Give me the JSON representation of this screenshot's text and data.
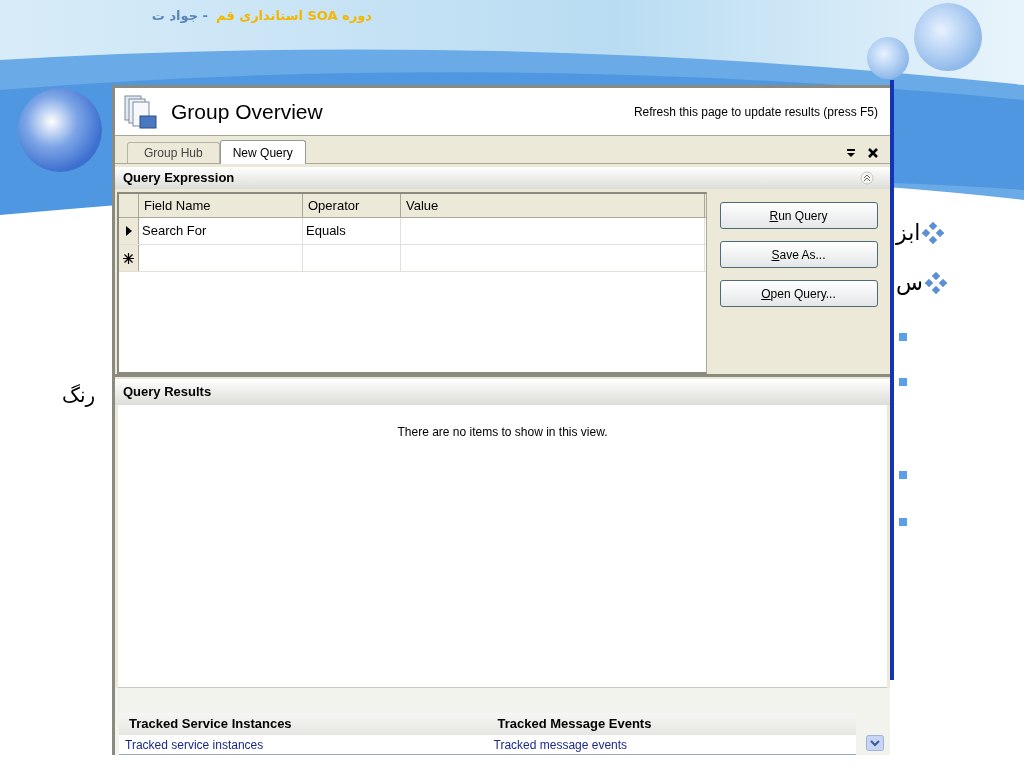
{
  "slide": {
    "header": {
      "course": "دوره SOA استانداری قم",
      "author": "- جواد ت"
    },
    "bullets": [
      {
        "kind": "diamond",
        "text": "ابز"
      },
      {
        "kind": "diamond",
        "text": "س"
      },
      {
        "kind": "square"
      },
      {
        "kind": "square"
      },
      {
        "kind": "square"
      },
      {
        "kind": "square"
      }
    ],
    "side_text": "رنگ"
  },
  "window": {
    "title": "Group Overview",
    "refresh_hint": "Refresh this page to update results (press F5)",
    "tabs": [
      {
        "label": "Group Hub",
        "selected": false
      },
      {
        "label": "New Query",
        "selected": true
      }
    ],
    "query_expression": {
      "title": "Query Expression",
      "columns": [
        "Field Name",
        "Operator",
        "Value"
      ],
      "rows": [
        {
          "kind": "current",
          "field_name": "Search For",
          "operator": "Equals"
        },
        {
          "kind": "new"
        }
      ],
      "buttons": [
        "Run Query",
        "Save As...",
        "Open Query..."
      ]
    },
    "query_results": {
      "title": "Query Results",
      "empty_message": "There are no items to show in this view."
    },
    "tracked": [
      {
        "heading": "Tracked Service Instances",
        "link": "Tracked service instances"
      },
      {
        "heading": "Tracked Message Events",
        "link": "Tracked message events"
      }
    ]
  }
}
